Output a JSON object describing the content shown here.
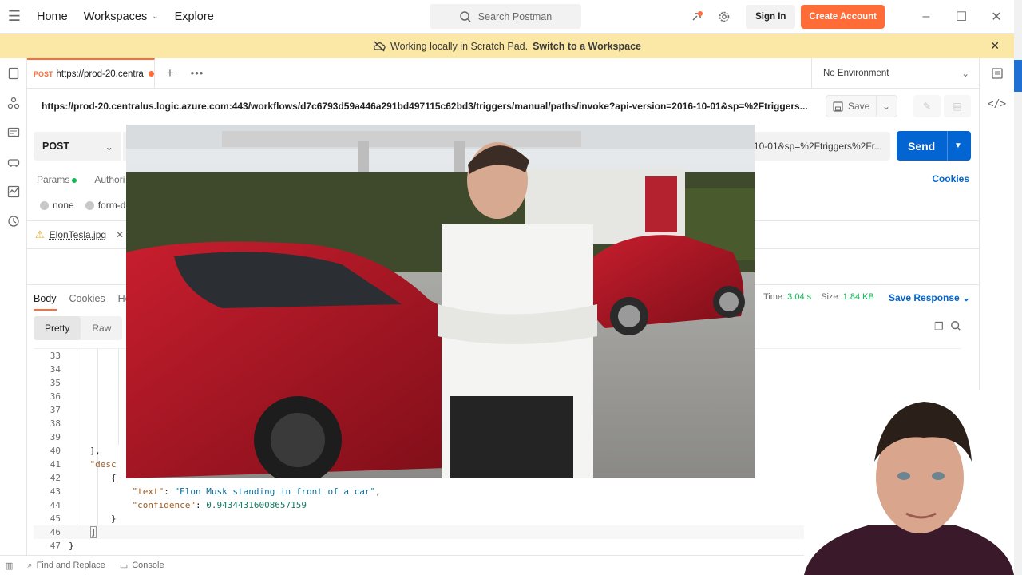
{
  "topbar": {
    "nav": [
      "Home",
      "Workspaces",
      "Explore"
    ],
    "search_placeholder": "Search Postman",
    "signin": "Sign In",
    "create": "Create Account"
  },
  "banner": {
    "text": "Working locally in Scratch Pad.",
    "link": "Switch to a Workspace"
  },
  "tab": {
    "method": "POST",
    "title": "https://prod-20.centra"
  },
  "environment": "No Environment",
  "request": {
    "url_title": "https://prod-20.centralus.logic.azure.com:443/workflows/d7c6793d59a446a291bd497115c62bd3/triggers/manual/paths/invoke?api-version=2016-10-01&sp=%2Ftriggers...",
    "method": "POST",
    "url_visible": "10-01&sp=%2Ftriggers%2Fr...",
    "save": "Save",
    "send": "Send"
  },
  "subtabs": {
    "params": "Params",
    "auth": "Authori",
    "cookies": "Cookies"
  },
  "body_options": [
    "none",
    "form-d"
  ],
  "file": {
    "name": "ElonTesla.jpg"
  },
  "response": {
    "tabs": [
      "Body",
      "Cookies",
      "He"
    ],
    "time_label": "Time:",
    "time": "3.04 s",
    "size_label": "Size:",
    "size": "1.84 KB",
    "save_response": "Save Response",
    "views": [
      "Pretty",
      "Raw"
    ]
  },
  "code": {
    "line_numbers": [
      "33",
      "34",
      "35",
      "36",
      "37",
      "38",
      "39",
      "40",
      "41",
      "42",
      "43",
      "44",
      "45",
      "46",
      "47"
    ],
    "l39": "}",
    "l40": "],",
    "l41": "\"desc",
    "l42": "{",
    "l43_key": "\"text\"",
    "l43_val": "\"Elon Musk standing in front of a car\"",
    "l44_key": "\"confidence\"",
    "l44_val": "0.94344316008657159",
    "l45": "}",
    "l46": "]",
    "l47": "}"
  },
  "status": {
    "find": "Find and Replace",
    "console": "Console"
  },
  "colors": {
    "accent": "#ff6c37",
    "send": "#0265d2",
    "banner": "#fce8a6"
  }
}
